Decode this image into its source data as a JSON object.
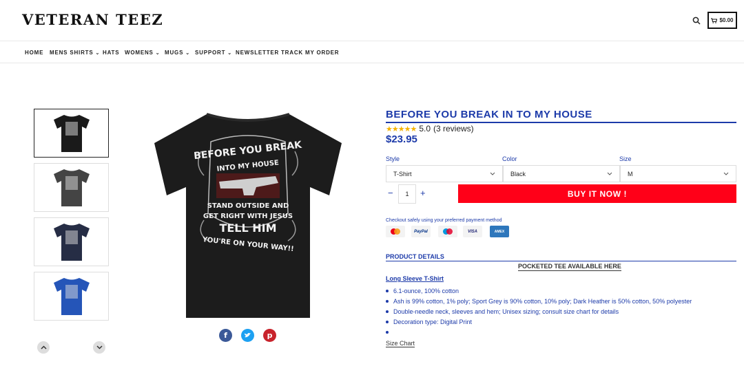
{
  "header": {
    "logo": "VETERAN TEEZ",
    "cart_total": "$0.00"
  },
  "nav": [
    {
      "label": "HOME",
      "dropdown": false
    },
    {
      "label": "MENS SHIRTS",
      "dropdown": true
    },
    {
      "label": "HATS",
      "dropdown": false
    },
    {
      "label": "WOMENS",
      "dropdown": true
    },
    {
      "label": "MUGS",
      "dropdown": true
    },
    {
      "label": "SUPPORT",
      "dropdown": true
    },
    {
      "label": "NEWSLETTER",
      "dropdown": false
    },
    {
      "label": "TRACK MY ORDER",
      "dropdown": false
    }
  ],
  "gallery": {
    "thumbnail_colors": [
      "#1a1a1a",
      "#444444",
      "#262d45",
      "#2555b8"
    ],
    "shirt": {
      "line1": "BEFORE YOU BREAK",
      "line2": "INTO MY HOUSE",
      "line3": "STAND OUTSIDE AND",
      "line4": "GET RIGHT WITH JESUS",
      "line5": "TELL HIM",
      "line6": "YOU'RE ON YOUR WAY!!"
    }
  },
  "product": {
    "title": "BEFORE YOU BREAK IN TO MY HOUSE",
    "stars": "★★★★★",
    "rating": "5.0",
    "reviews": "(3 reviews)",
    "price": "$23.95",
    "style_label": "Style",
    "style_value": "T-Shirt",
    "color_label": "Color",
    "color_value": "Black",
    "size_label": "Size",
    "size_value": "M",
    "quantity": "1",
    "buy_label": "BUY IT NOW !",
    "checkout_text": "Checkout safely using your preferred payment method",
    "payment_methods": [
      "mastercard",
      "PayPal",
      "maestro",
      "VISA",
      "AMEX"
    ],
    "details_title": "PRODUCT DETAILS",
    "pocketed": "POCKETED TEE AVAILABLE HERE",
    "long_sleeve": "Long Sleeve T-Shirt",
    "bullets": [
      "6.1-ounce, 100% cotton",
      "Ash is 99% cotton, 1% poly; Sport Grey is 90% cotton, 10% poly; Dark Heather is 50% cotton, 50% polyester",
      "Double-needle neck, sleeves and hem; Unisex sizing; consult size chart for details",
      "Decoration type: Digital Print",
      ""
    ],
    "size_chart": "Size Chart"
  },
  "colors": {
    "accent": "#1c3aa9",
    "buy": "#ff0018"
  }
}
